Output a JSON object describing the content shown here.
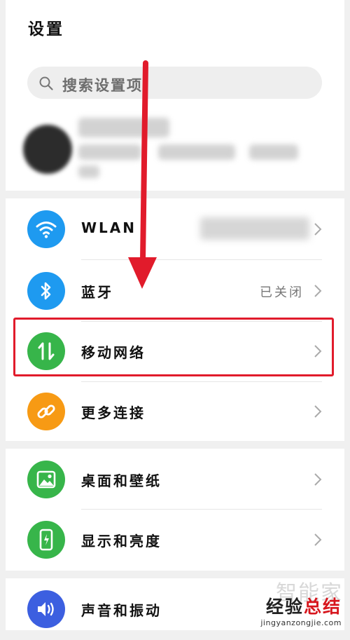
{
  "header": {
    "title": "设置"
  },
  "search": {
    "placeholder": "搜索设置项",
    "icon": "search-icon"
  },
  "account": {
    "avatar": "avatar"
  },
  "sections": [
    {
      "items": [
        {
          "label": "WLAN",
          "value": "",
          "icon": "wifi-icon",
          "color": "#1e9af0"
        },
        {
          "label": "蓝牙",
          "value": "已关闭",
          "icon": "bluetooth-icon",
          "color": "#1e9af0"
        },
        {
          "label": "移动网络",
          "value": "",
          "icon": "mobile-network-icon",
          "color": "#37b54a"
        },
        {
          "label": "更多连接",
          "value": "",
          "icon": "link-icon",
          "color": "#f79a14"
        }
      ]
    },
    {
      "items": [
        {
          "label": "桌面和壁纸",
          "value": "",
          "icon": "wallpaper-icon",
          "color": "#37b54a"
        },
        {
          "label": "显示和亮度",
          "value": "",
          "icon": "display-icon",
          "color": "#37b54a"
        }
      ]
    },
    {
      "items": [
        {
          "label": "声音和振动",
          "value": "",
          "icon": "sound-icon",
          "color": "#3c5fe0"
        }
      ]
    }
  ],
  "annotation": {
    "color": "#e11b2b"
  },
  "watermark": {
    "main_a": "经验",
    "main_b": "总结",
    "url": "jingyanzongjie.com",
    "ghost": "智能家"
  }
}
